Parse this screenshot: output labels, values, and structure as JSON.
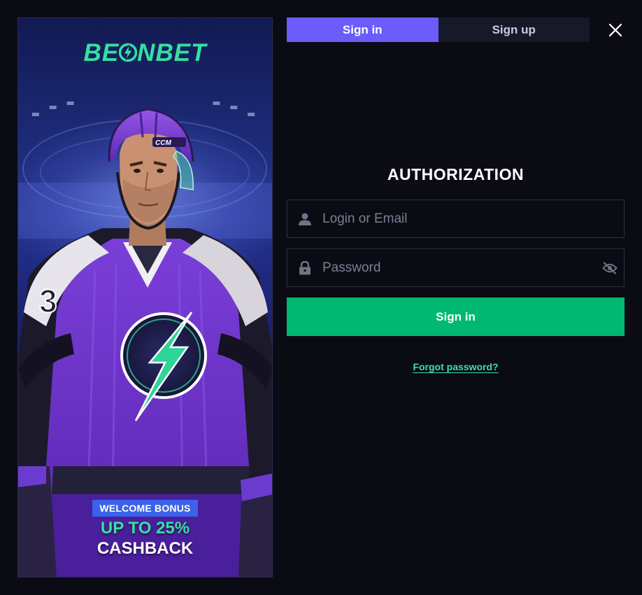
{
  "banner": {
    "logo_text_left": "BE",
    "logo_text_right": "NBET",
    "jersey_number": "3",
    "helmet_text": "CCM",
    "bonus_tag": "WELCOME BONUS",
    "bonus_line1": "UP TO 25%",
    "bonus_line2": "CASHBACK"
  },
  "tabs": [
    {
      "label": "Sign in",
      "active": true
    },
    {
      "label": "Sign up",
      "active": false
    }
  ],
  "form": {
    "title": "AUTHORIZATION",
    "login_placeholder": "Login or Email",
    "login_value": "",
    "password_placeholder": "Password",
    "password_value": "",
    "submit_label": "Sign in",
    "forgot_label": "Forgot password?"
  },
  "icons": {
    "close": "close-icon",
    "user": "user-icon",
    "lock": "lock-icon",
    "eye_off": "eye-off-icon",
    "bolt": "lightning-bolt-icon"
  },
  "colors": {
    "background": "#0b0c13",
    "tab_active": "#6b5cfb",
    "tab_inactive": "#161a28",
    "primary_button": "#00b871",
    "brand_green": "#34e0a1",
    "bonus_tag": "#3b62ea"
  }
}
